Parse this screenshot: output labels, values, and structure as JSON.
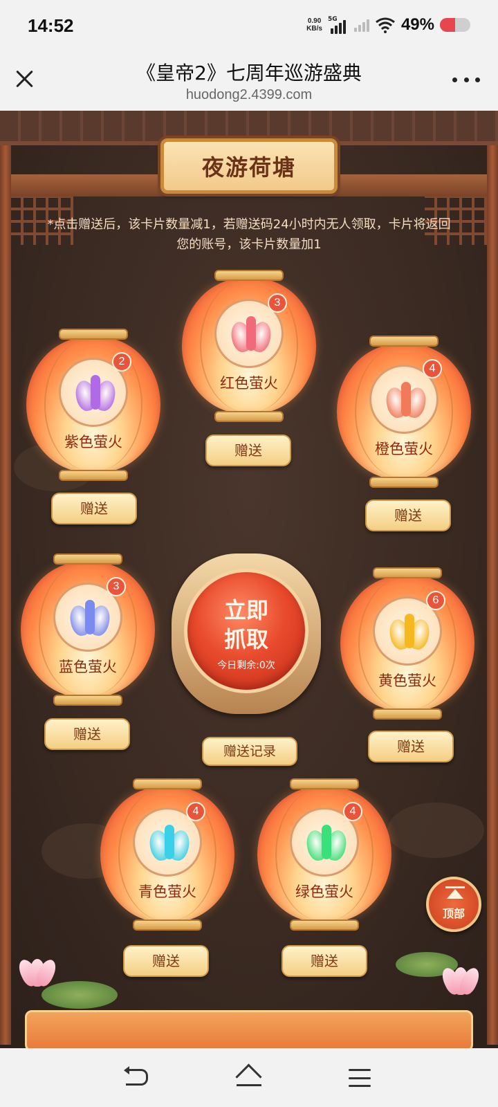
{
  "status_bar": {
    "time": "14:52",
    "net_speed_value": "0.90",
    "net_speed_unit": "KB/s",
    "network": "5G",
    "battery_text": "49%",
    "battery_level": 0.49,
    "battery_color": "#e8464f"
  },
  "browser": {
    "title": "《皇帝2》七周年巡游盛典",
    "url": "huodong2.4399.com",
    "close_icon": "close-icon",
    "more_icon": "more-icon"
  },
  "event": {
    "section_title": "夜游荷塘",
    "notice": "*点击赠送后，该卡片数量减1，若赠送码24小时内无人领取，卡片将返回您的账号，该卡片数量加1",
    "catch_button": {
      "label_line1": "立即",
      "label_line2": "抓取",
      "remaining": "今日剩余:0次"
    },
    "record_button": "赠送记录",
    "top_button": "顶部",
    "lanterns": [
      {
        "name": "红色萤火",
        "count": "3",
        "color": "#f06a7a",
        "gift_label": "赠送"
      },
      {
        "name": "紫色萤火",
        "count": "2",
        "color": "#b06ae8",
        "gift_label": "赠送"
      },
      {
        "name": "橙色萤火",
        "count": "4",
        "color": "#f07a5a",
        "gift_label": "赠送"
      },
      {
        "name": "蓝色萤火",
        "count": "3",
        "color": "#7a8af0",
        "gift_label": "赠送"
      },
      {
        "name": "黄色萤火",
        "count": "6",
        "color": "#f5b820",
        "gift_label": "赠送"
      },
      {
        "name": "青色萤火",
        "count": "4",
        "color": "#3ad0e8",
        "gift_label": "赠送"
      },
      {
        "name": "绿色萤火",
        "count": "4",
        "color": "#3ae07a",
        "gift_label": "赠送"
      }
    ]
  },
  "nav_bar": {
    "back_icon": "back-icon",
    "home_icon": "home-icon",
    "menu_icon": "menu-icon"
  }
}
